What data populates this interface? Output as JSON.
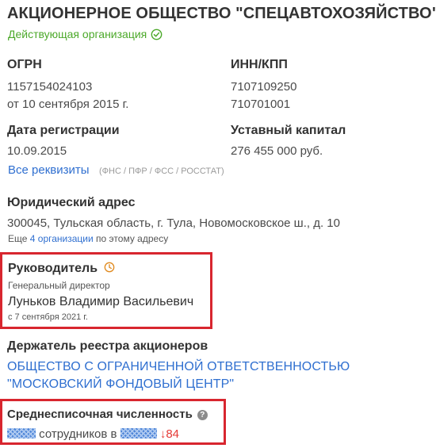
{
  "company": {
    "title": "АКЦИОНЕРНОЕ ОБЩЕСТВО \"СПЕЦАВТОХОЗЯЙСТВО\"",
    "status": "Действующая организация",
    "status_icon": "check-circle-icon",
    "status_color": "#4ca92a"
  },
  "ogrn": {
    "label": "ОГРН",
    "value": "1157154024103",
    "date": "от 10 сентября 2015 г."
  },
  "inn_kpp": {
    "label": "ИНН/КПП",
    "inn": "7107109250",
    "kpp": "710701001"
  },
  "registration": {
    "label": "Дата регистрации",
    "value": "10.09.2015"
  },
  "capital": {
    "label": "Уставный капитал",
    "value": "276 455 000 руб."
  },
  "requisites": {
    "link": "Все реквизиты",
    "agencies": "(ФНС / ПФР / ФСС / РОССТАТ)"
  },
  "address": {
    "label": "Юридический адрес",
    "value": "300045, Тульская область, г. Тула, Новомосковское ш., д. 10",
    "more_prefix": "Еще",
    "more_link": "4 организации",
    "more_suffix": "по этому адресу"
  },
  "director": {
    "label": "Руководитель",
    "history_icon": "clock-icon",
    "position": "Генеральный директор",
    "name": "Луньков Владимир Васильевич",
    "since": "с 7 сентября 2021 г."
  },
  "holder": {
    "label": "Держатель реестра акционеров",
    "link": "ОБЩЕСТВО С ОГРАНИЧЕННОЙ ОТВЕТСТВЕННОСТЬЮ \"МОСКОВСКИЙ ФОНДОВЫЙ ЦЕНТР\""
  },
  "employees": {
    "label": "Среднесписочная численность",
    "help_icon": "question-icon",
    "text": "сотрудников в",
    "change": "↓84",
    "change_color": "#e53935"
  },
  "colors": {
    "link": "#2f6fd0",
    "highlight_border": "#d8262f"
  }
}
